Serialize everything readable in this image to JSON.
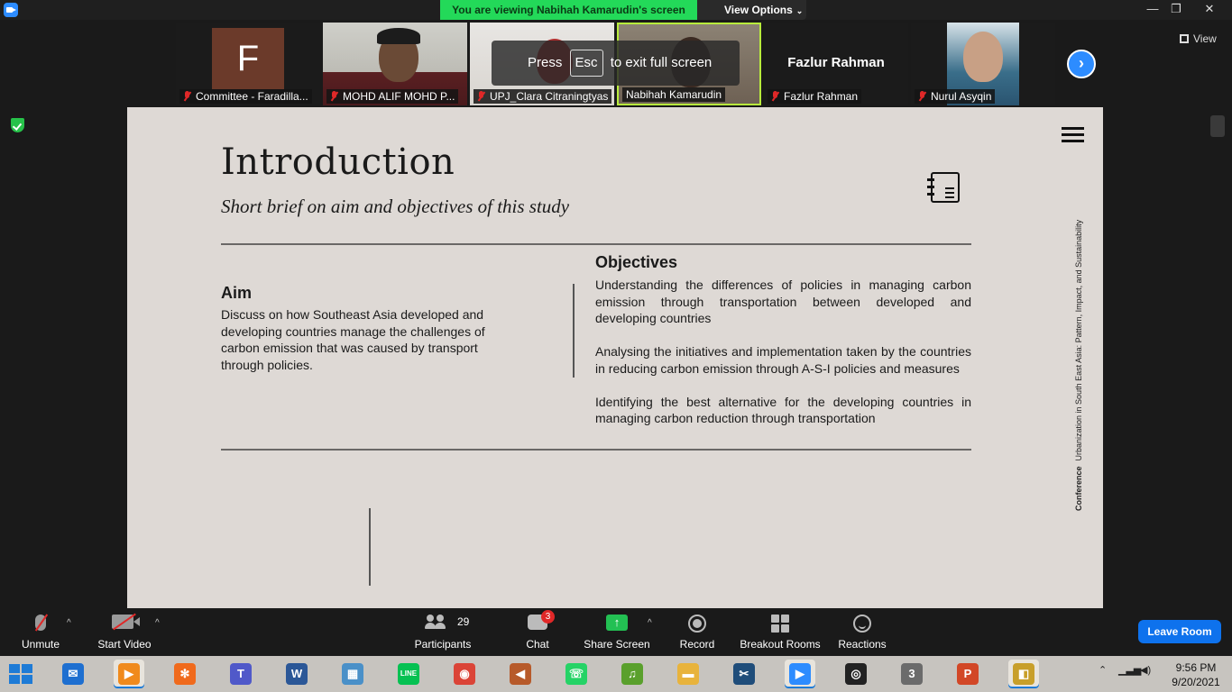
{
  "window": {
    "share_banner": "You are viewing Nabihah Kamarudin's screen",
    "view_options": "View Options",
    "controls": {
      "minimize": "—",
      "restore": "❐",
      "close": "✕"
    }
  },
  "participants": [
    {
      "name": "Committee - Faradilla...",
      "avatar_letter": "F",
      "muted": true
    },
    {
      "name": "MOHD ALIF MOHD P...",
      "muted": true
    },
    {
      "name": "UPJ_Clara Citraningtyas",
      "muted": true
    },
    {
      "name": "Nabihah Kamarudin",
      "muted": false
    },
    {
      "name": "Fazlur Rahman",
      "video_name": "Fazlur Rahman",
      "muted": true
    },
    {
      "name": "Nurul Asyqin",
      "muted": true
    }
  ],
  "view_button": "View",
  "fullscreen_hint": {
    "prefix": "Press",
    "key": "Esc",
    "suffix": "to exit full screen"
  },
  "slide": {
    "title": "Introduction",
    "subtitle": "Short brief on aim and objectives of this study",
    "aim_heading": "Aim",
    "aim_text": "Discuss on how Southeast Asia developed and developing countries manage the challenges of carbon emission that was caused by transport through policies.",
    "objectives_heading": "Objectives",
    "objectives": [
      "Understanding the differences of policies in managing carbon emission through transportation between developed and developing countries",
      "Analysing the initiatives and implementation taken by the countries in reducing carbon emission through A-S-I policies and measures",
      "Identifying the best alternative for the developing countries in managing carbon reduction through transportation"
    ],
    "side_label_bold": "Conference",
    "side_label": "Urbanization in South East Asia: Pattern, Impact, and Sustainability"
  },
  "toolbar": {
    "unmute": "Unmute",
    "start_video": "Start Video",
    "participants": "Participants",
    "participant_count": "29",
    "chat": "Chat",
    "chat_badge": "3",
    "share_screen": "Share Screen",
    "share_icon": "↑",
    "record": "Record",
    "breakout_rooms": "Breakout Rooms",
    "reactions": "Reactions",
    "leave": "Leave Room",
    "caret": "^"
  },
  "taskbar": {
    "apps": [
      {
        "name": "Mail",
        "color": "#1e6fd0",
        "glyph": "✉"
      },
      {
        "name": "Media Player",
        "color": "#f08a1c",
        "glyph": "▶"
      },
      {
        "name": "XAMPP",
        "color": "#f06a1c",
        "glyph": "✻"
      },
      {
        "name": "Teams",
        "color": "#5059c9",
        "glyph": "T"
      },
      {
        "name": "Word",
        "color": "#2b5797",
        "glyph": "W"
      },
      {
        "name": "Control Panel",
        "color": "#4a90c8",
        "glyph": "▦"
      },
      {
        "name": "LINE",
        "color": "#06c152",
        "glyph": "LINE"
      },
      {
        "name": "Chrome",
        "color": "#db4437",
        "glyph": "◉"
      },
      {
        "name": "Volume",
        "color": "#b75a2a",
        "glyph": "◀"
      },
      {
        "name": "WhatsApp",
        "color": "#25d366",
        "glyph": "☏"
      },
      {
        "name": "Evernote",
        "color": "#5aa02c",
        "glyph": "♫"
      },
      {
        "name": "File Explorer",
        "color": "#e8b33c",
        "glyph": "▬"
      },
      {
        "name": "Snip",
        "color": "#1f4d7a",
        "glyph": "✂"
      },
      {
        "name": "Zoom",
        "color": "#2d8cff",
        "glyph": "▶"
      },
      {
        "name": "OBS",
        "color": "#222222",
        "glyph": "◎"
      },
      {
        "name": "Video Editor",
        "color": "#6b6b6b",
        "glyph": "3"
      },
      {
        "name": "PowerPoint",
        "color": "#d24726",
        "glyph": "P"
      },
      {
        "name": "Project",
        "color": "#c89f2a",
        "glyph": "◧"
      }
    ],
    "time": "9:56 PM",
    "date": "9/20/2021"
  }
}
